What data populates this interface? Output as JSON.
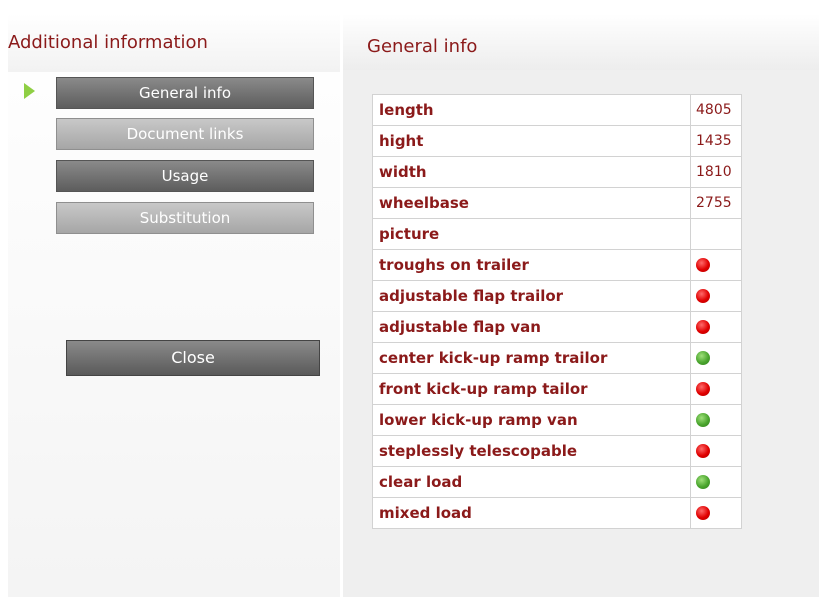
{
  "sidebar": {
    "title": "Additional information",
    "buttons": [
      {
        "label": "General info",
        "style": "dark",
        "active": true
      },
      {
        "label": "Document links",
        "style": "light"
      },
      {
        "label": "Usage",
        "style": "dark"
      },
      {
        "label": "Substitution",
        "style": "light"
      }
    ],
    "close_label": "Close"
  },
  "main": {
    "title": "General info",
    "rows": [
      {
        "name": "length",
        "value": "4805"
      },
      {
        "name": "hight",
        "value": "1435"
      },
      {
        "name": "width",
        "value": "1810"
      },
      {
        "name": "wheelbase",
        "value": "2755"
      },
      {
        "name": "picture",
        "value": ""
      },
      {
        "name": "troughs on trailer",
        "status": "red"
      },
      {
        "name": "adjustable flap trailor",
        "status": "red"
      },
      {
        "name": "adjustable flap van",
        "status": "red"
      },
      {
        "name": "center kick-up ramp trailor",
        "status": "green"
      },
      {
        "name": "front kick-up ramp tailor",
        "status": "red"
      },
      {
        "name": "lower kick-up ramp van",
        "status": "green"
      },
      {
        "name": "steplessly telescopable",
        "status": "red"
      },
      {
        "name": "clear load",
        "status": "green"
      },
      {
        "name": "mixed load",
        "status": "red"
      }
    ]
  },
  "colors": {
    "accent": "#8b1a1a",
    "active_arrow": "#8fcf44",
    "status_red": "#e00000",
    "status_green": "#4aa52e"
  },
  "icons": {
    "active_marker": "triangle-right-icon",
    "status": "status-dot-icon"
  }
}
